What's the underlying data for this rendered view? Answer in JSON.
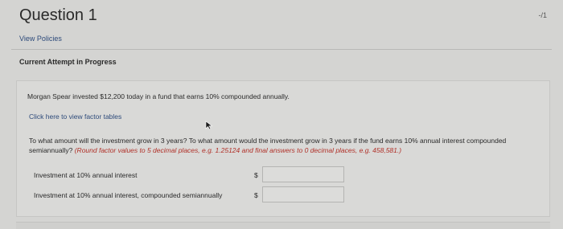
{
  "header": {
    "title": "Question 1",
    "score": "-/1"
  },
  "links": {
    "view_policies": "View Policies"
  },
  "attempt": {
    "label": "Current Attempt in Progress"
  },
  "question": {
    "text": "Morgan Spear invested $12,200 today in a fund that earns 10% compounded annually.",
    "factor_link": "Click here to view factor tables",
    "prompt": "To what amount will the investment grow in 3 years? To what amount would the investment grow in 3 years if the fund earns 10% annual interest compounded semiannually?",
    "instructions": "(Round factor values to 5 decimal places, e.g. 1.25124 and final answers to 0 decimal places, e.g. 458,581.)"
  },
  "answers": [
    {
      "label": "Investment at 10% annual interest",
      "currency": "$",
      "value": ""
    },
    {
      "label": "Investment at 10% annual interest, compounded semiannually",
      "currency": "$",
      "value": ""
    }
  ],
  "icons": {
    "cursor": "mouse-pointer-icon"
  },
  "colors": {
    "link": "#2d4a7a",
    "instruction": "#b03028",
    "background": "#d4d4d2"
  }
}
